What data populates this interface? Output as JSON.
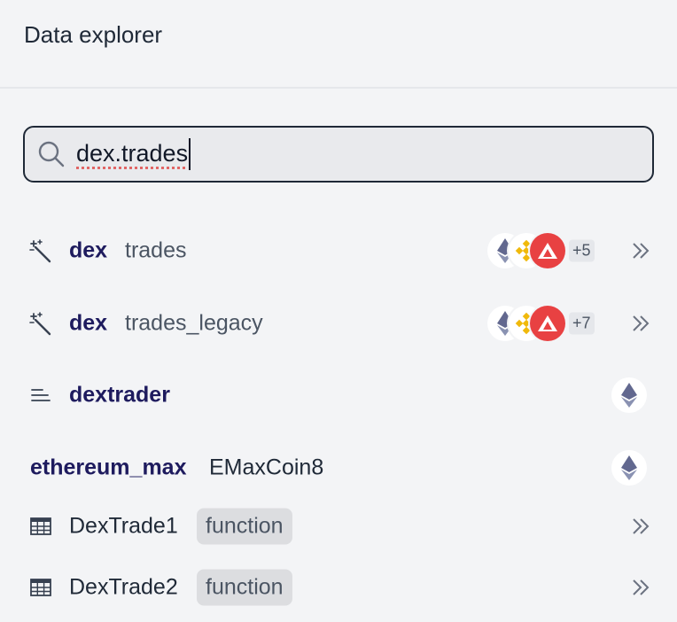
{
  "header": {
    "title": "Data explorer"
  },
  "search": {
    "value": "dex.trades",
    "placeholder": ""
  },
  "results": [
    {
      "namespace": "dex",
      "table": "trades",
      "extra_chains": "+5"
    },
    {
      "namespace": "dex",
      "table": "trades_legacy",
      "extra_chains": "+7"
    },
    {
      "name": "dextrader"
    },
    {
      "namespace": "ethereum_max",
      "table": "EMaxCoin8"
    },
    {
      "name": "DexTrade1",
      "tag": "function"
    },
    {
      "name": "DexTrade2",
      "tag": "function"
    }
  ],
  "icons": {
    "spell": "magic-wand-icon",
    "schema": "lines-icon",
    "table": "table-grid-icon",
    "expand": "double-chevron-right-icon",
    "chains": [
      "ethereum-icon",
      "bnb-icon",
      "avalanche-icon"
    ]
  },
  "colors": {
    "accent_text": "#1e1b5e",
    "avalanche": "#e84142",
    "bnb": "#f0b90b",
    "ethereum": "#62688f"
  }
}
